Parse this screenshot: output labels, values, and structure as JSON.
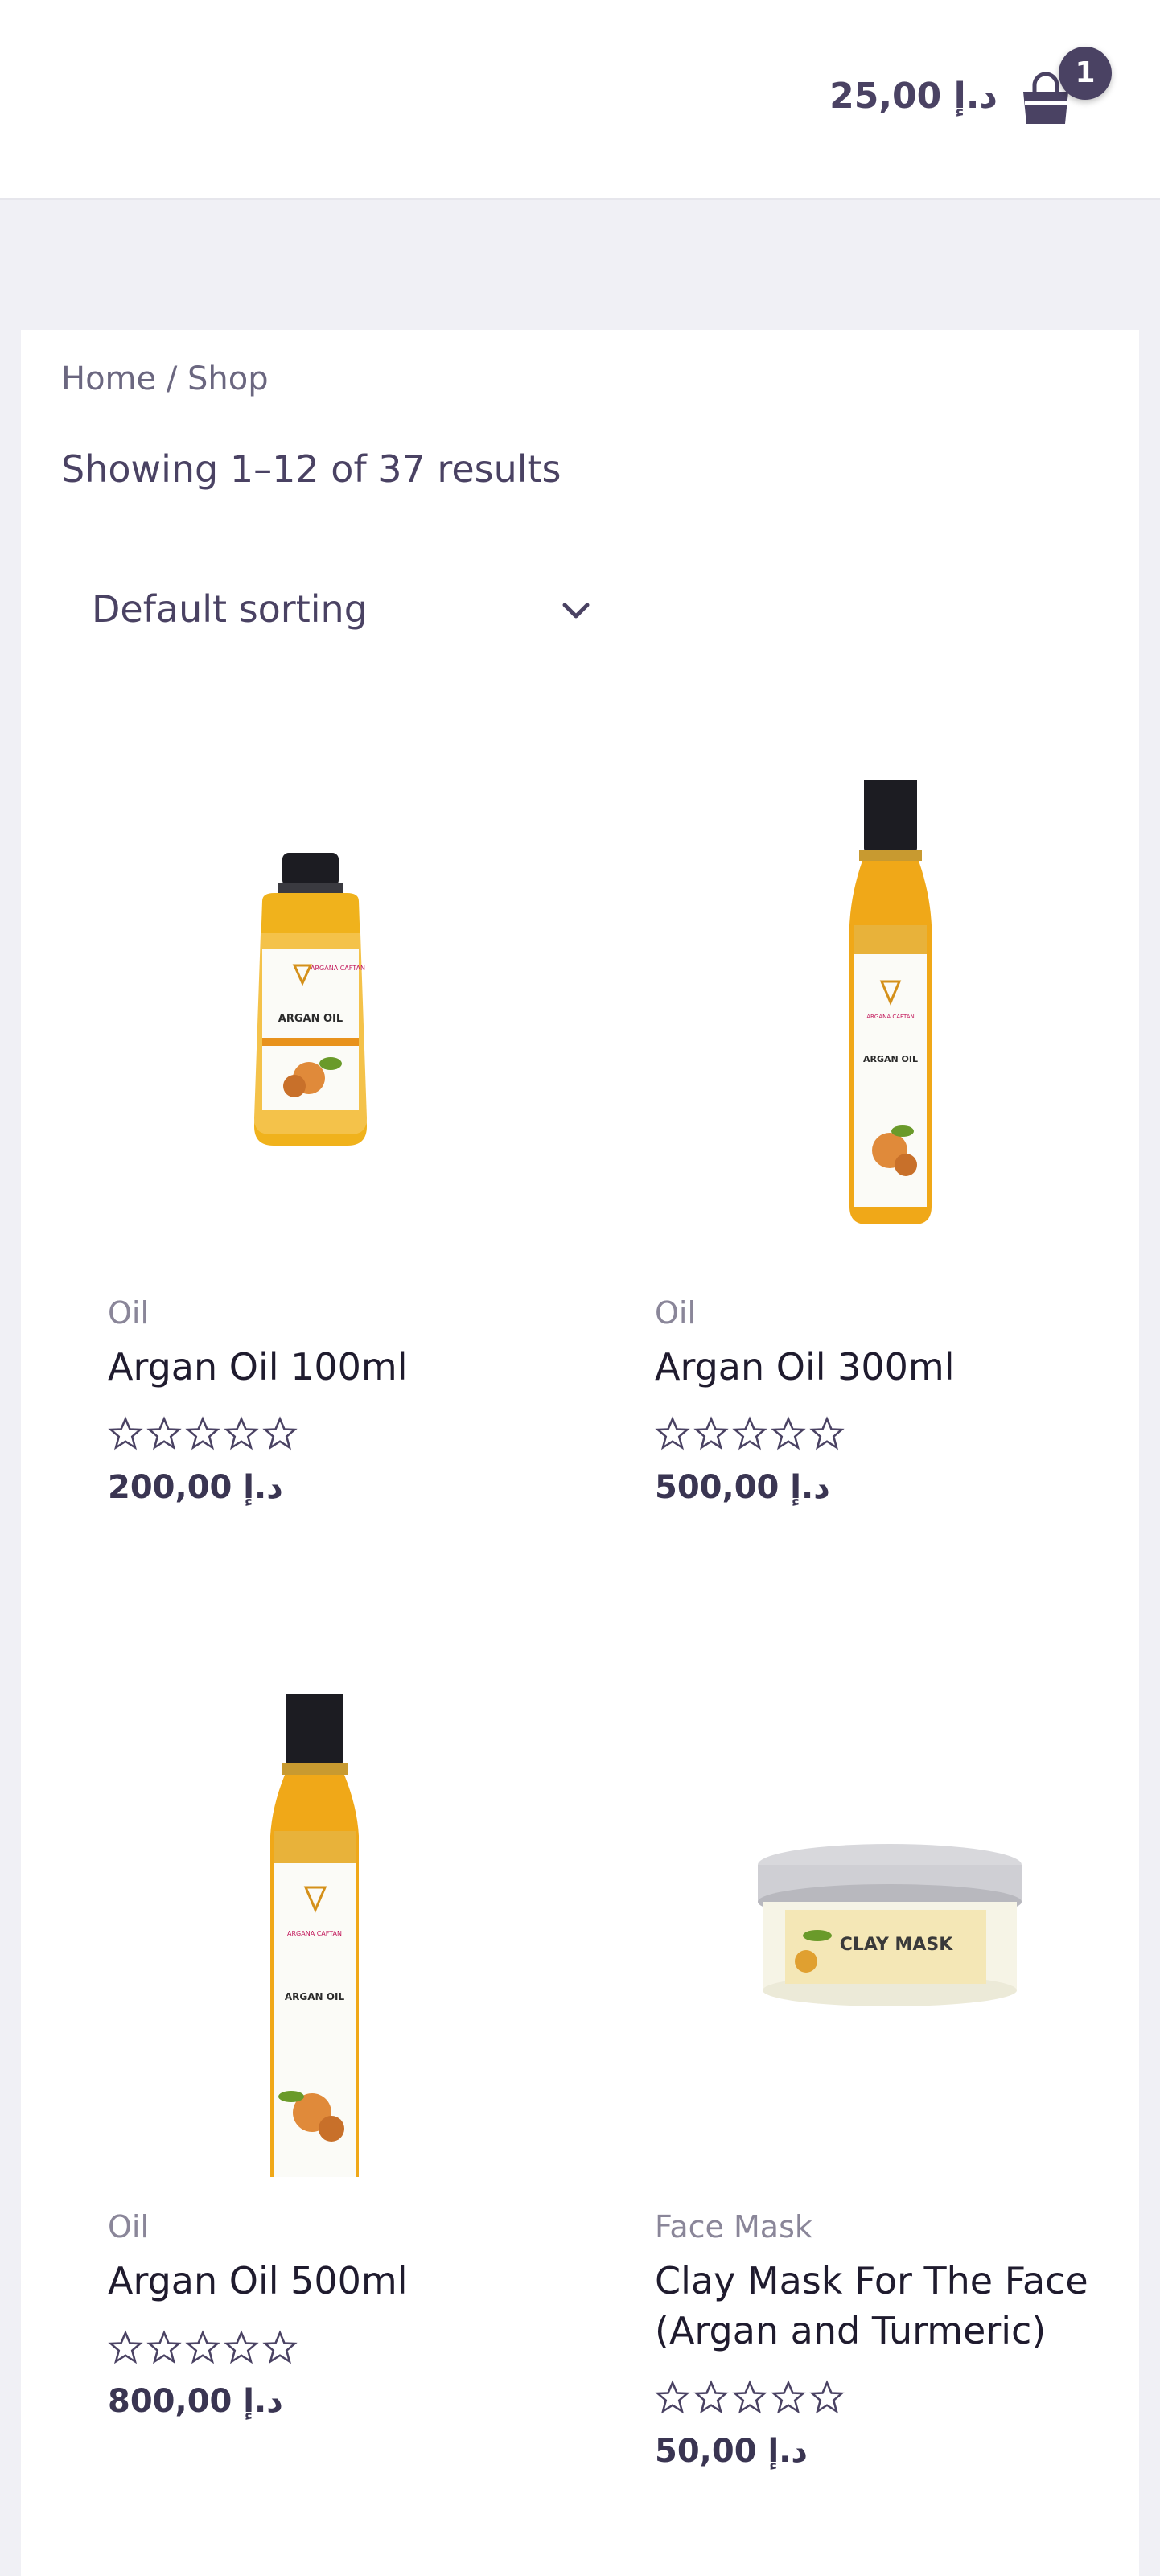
{
  "header": {
    "cart_total": "د.إ 25,00",
    "cart_count": "1",
    "cart_icon": "shopping-bag-icon"
  },
  "breadcrumb": {
    "home": "Home",
    "separator": " / ",
    "current": "Shop"
  },
  "result_count": "Showing 1–12 of 37 results",
  "sorting": {
    "selected": "Default sorting"
  },
  "products": [
    {
      "category": "Oil",
      "title": "Argan Oil 100ml",
      "rating": 0,
      "price": "د.إ 200,00"
    },
    {
      "category": "Oil",
      "title": "Argan Oil 300ml",
      "rating": 0,
      "price": "د.إ 500,00"
    },
    {
      "category": "Oil",
      "title": "Argan Oil 500ml",
      "rating": 0,
      "price": "د.إ 800,00"
    },
    {
      "category": "Face Mask",
      "title": "Clay Mask For The Face (Argan and Turmeric)",
      "rating": 0,
      "price": "د.إ 50,00"
    }
  ],
  "product_labels": {
    "bottle_brand": "ARGANA CAFTAN",
    "bottle_name": "ARGAN OIL",
    "jar_name": "CLAY MASK"
  },
  "colors": {
    "accent": "#4a4263",
    "page_bg": "#f0f0f5",
    "oil": "#e8a11c"
  }
}
